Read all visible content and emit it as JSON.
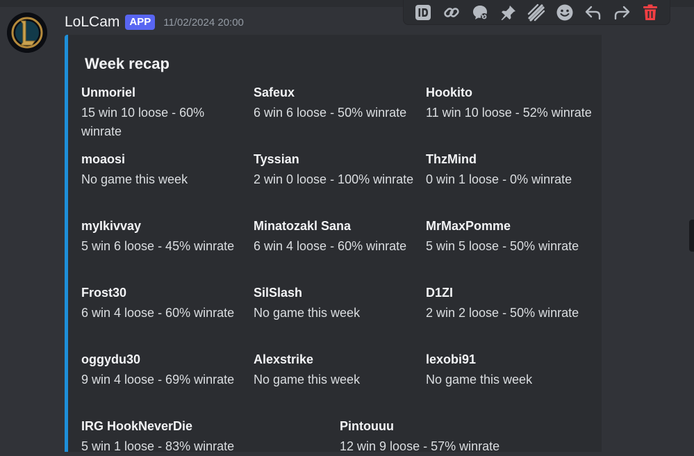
{
  "message": {
    "username": "LoLCam",
    "badge": "APP",
    "timestamp": "11/02/2024 20:00",
    "avatar_icon": "league-of-legends-logo-icon"
  },
  "toolbar": {
    "icons": [
      "id-icon",
      "link-icon",
      "thread-icon",
      "pin-icon",
      "apps-icon",
      "emoji-icon",
      "reply-icon",
      "forward-icon",
      "delete-icon"
    ],
    "delete_color": "#f23f43"
  },
  "embed": {
    "title": "Week recap",
    "accent_color": "#1e8fd8",
    "rows": [
      [
        {
          "name": "Unmoriel",
          "value": "15 win 10 loose - 60% winrate"
        },
        {
          "name": "Safeux",
          "value": "6 win 6 loose - 50% winrate"
        },
        {
          "name": "Hookito",
          "value": "11 win 10 loose - 52% winrate"
        }
      ],
      [
        {
          "name": "moaosi",
          "value": "No game this week"
        },
        {
          "name": "Tyssian",
          "value": "2 win 0 loose - 100% winrate"
        },
        {
          "name": "ThzMind",
          "value": "0 win 1 loose - 0% winrate"
        }
      ],
      [
        {
          "name": "myIkivvay",
          "value": "5 win 6 loose - 45% winrate"
        },
        {
          "name": "Minatozakl Sana",
          "value": "6 win 4 loose - 60% winrate"
        },
        {
          "name": "MrMaxPomme",
          "value": "5 win 5 loose - 50% winrate"
        }
      ],
      [
        {
          "name": "Frost30",
          "value": "6 win 4 loose - 60% winrate"
        },
        {
          "name": "SilSlash",
          "value": "No game this week"
        },
        {
          "name": "D1ZI",
          "value": "2 win 2 loose - 50% winrate"
        }
      ],
      [
        {
          "name": "oggydu30",
          "value": "9 win 4 loose - 69% winrate"
        },
        {
          "name": "Alexstrike",
          "value": "No game this week"
        },
        {
          "name": "lexobi91",
          "value": "No game this week"
        }
      ],
      [
        {
          "name": "IRG HookNeverDie",
          "value": "5 win 1 loose - 83% winrate"
        },
        {
          "name": "Pintouuu",
          "value": "12 win 9 loose - 57% winrate"
        }
      ]
    ]
  }
}
